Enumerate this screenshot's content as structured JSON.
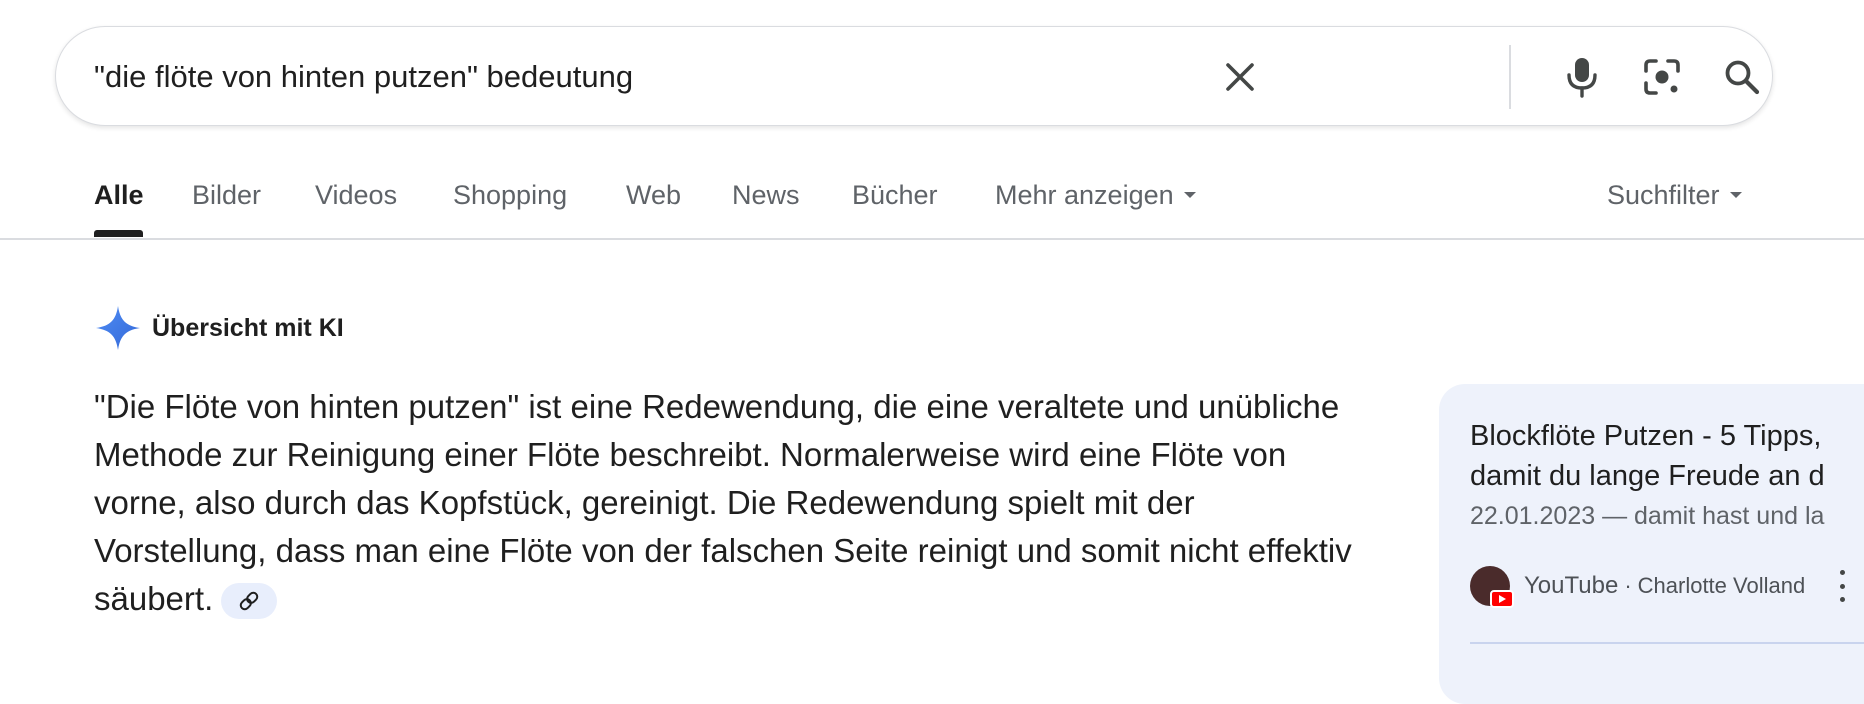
{
  "search": {
    "query": "\"die flöte von hinten putzen\" bedeutung"
  },
  "icons": {
    "clear": "close-icon",
    "voice": "mic-icon",
    "lens": "camera-lens-icon",
    "search": "search-icon",
    "ai": "sparkle-icon",
    "link": "link-icon",
    "more": "more-vert-icon"
  },
  "tabs": [
    {
      "label": "Alle"
    },
    {
      "label": "Bilder"
    },
    {
      "label": "Videos"
    },
    {
      "label": "Shopping"
    },
    {
      "label": "Web"
    },
    {
      "label": "News"
    },
    {
      "label": "Bücher"
    },
    {
      "label": "Mehr anzeigen"
    }
  ],
  "tools_label": "Suchfilter",
  "ai_overview": {
    "title": "Übersicht mit KI",
    "text": "\"Die Flöte von hinten putzen\" ist eine Redewendung, die eine veraltete und unübliche Methode zur Reinigung einer Flöte beschreibt. Normalerweise wird eine Flöte von vorne, also durch das Kopfstück, gereinigt. Die Redewendung spielt mit der Vorstellung, dass man eine Flöte von der falschen Seite reinigt und somit nicht effektiv säubert."
  },
  "source_card": {
    "title_line1": "Blockflöte Putzen - 5 Tipps,",
    "title_line2": "damit du lange Freude an d",
    "date_snippet": "22.01.2023 — damit hast und la",
    "site": "YouTube",
    "separator": "·",
    "author": "Charlotte Volland"
  },
  "colors": {
    "ai_accent": "#4285f4",
    "card_bg": "#eef2fb",
    "chip_bg": "#e8eefc"
  }
}
